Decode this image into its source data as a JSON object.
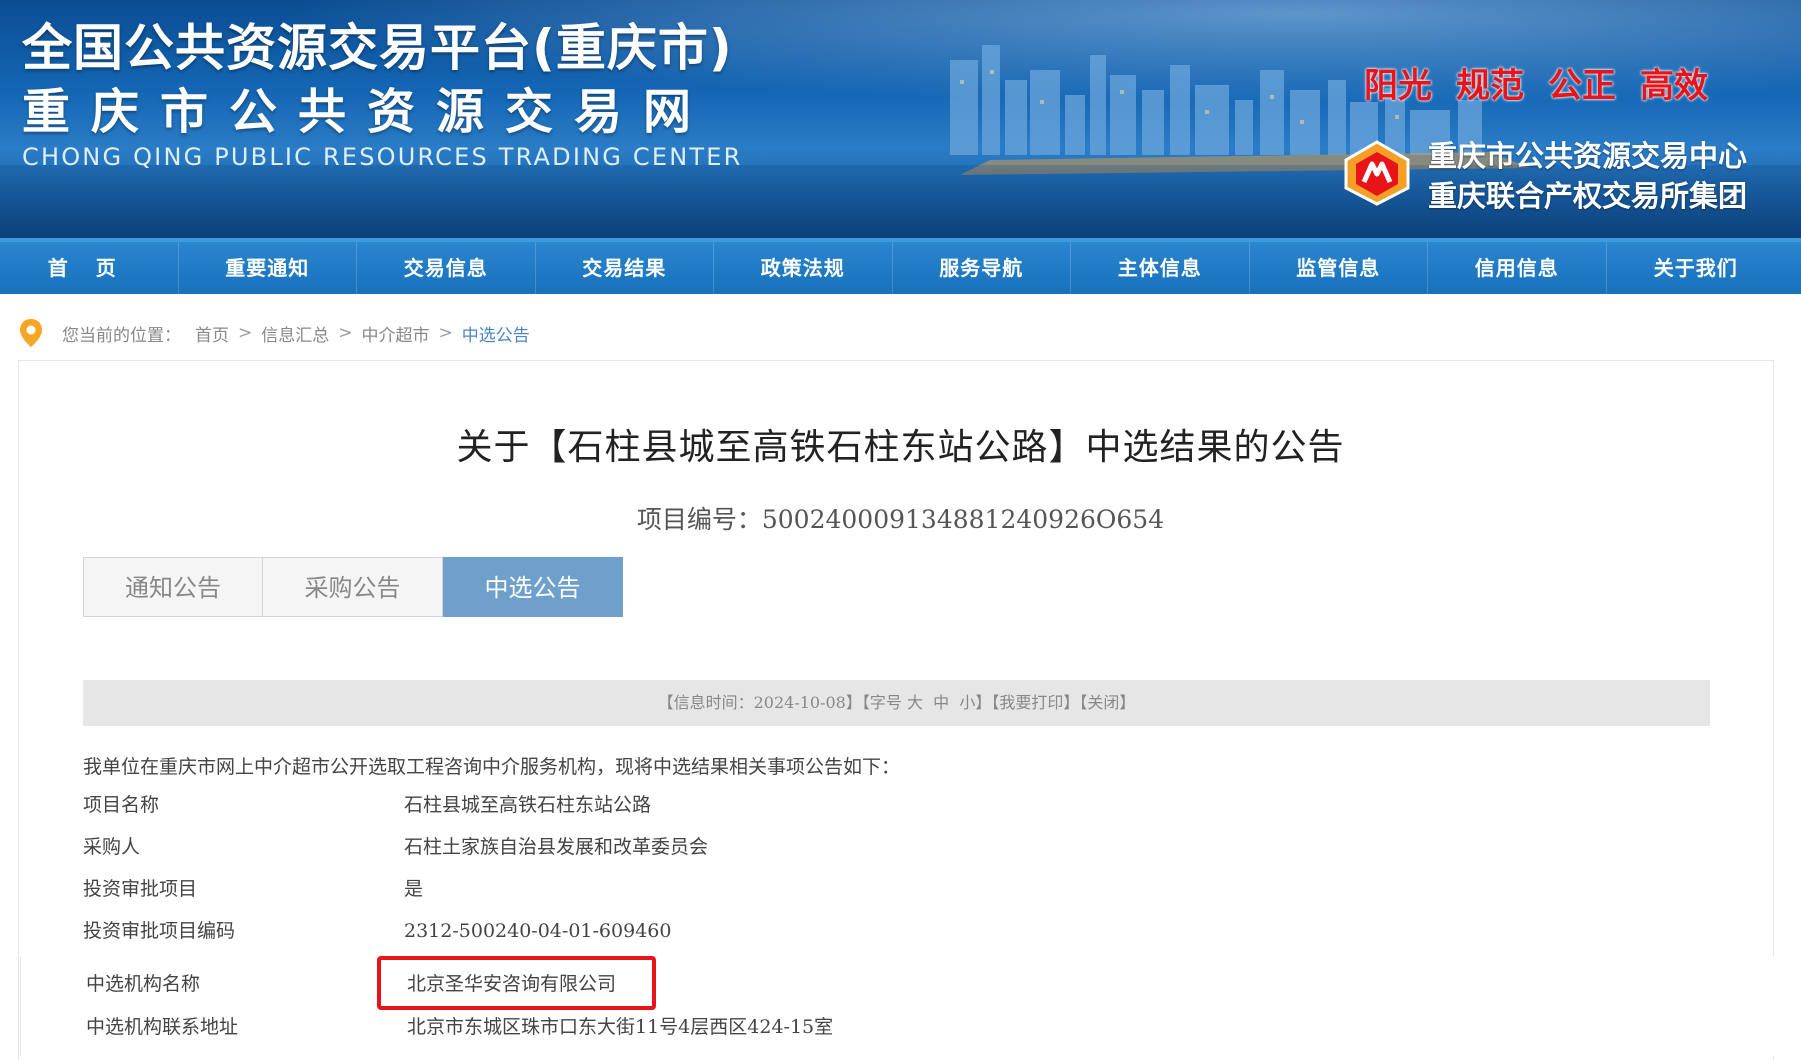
{
  "header": {
    "title": "全国公共资源交易平台(重庆市)",
    "subtitle": "重庆市公共资源交易网",
    "title_en": "CHONG QING PUBLIC RESOURCES TRADING CENTER",
    "slogans": [
      "阳光",
      "规范",
      "公正",
      "高效"
    ],
    "org_lines": [
      "重庆市公共资源交易中心",
      "重庆联合产权交易所集团"
    ],
    "colors": {
      "slogan": "#e8141a",
      "banner": "#1466b4"
    }
  },
  "nav": {
    "items": [
      "首页",
      "重要通知",
      "交易信息",
      "交易结果",
      "政策法规",
      "服务导航",
      "主体信息",
      "监管信息",
      "信用信息",
      "关于我们"
    ]
  },
  "breadcrumb": {
    "label": "您当前的位置：",
    "items": [
      "首页",
      "信息汇总",
      "中介超市",
      "中选公告"
    ],
    "separator": ">"
  },
  "article": {
    "title": "关于【石柱县城至高铁石柱东站公路】中选结果的公告",
    "project_no": "项目编号：500240009134881240926O654",
    "tabs": [
      "通知公告",
      "采购公告",
      "中选公告"
    ],
    "active_tab": "中选公告",
    "info_bar": {
      "time": "【信息时间：2024-10-08】",
      "font_prefix": "【字号",
      "font_large": "大",
      "font_medium": "中",
      "font_small": "小】",
      "print": "【我要打印】",
      "close": "【关闭】"
    },
    "intro": "我单位在重庆市网上中介超市公开选取工程咨询中介服务机构，现将中选结果相关事项公告如下：",
    "fields": [
      {
        "key": "项目名称",
        "value": "石柱县城至高铁石柱东站公路"
      },
      {
        "key": "采购人",
        "value": "石柱土家族自治县发展和改革委员会"
      },
      {
        "key": "投资审批项目",
        "value": "是"
      },
      {
        "key": "投资审批项目编码",
        "value": "2312-500240-04-01-609460"
      },
      {
        "key": "中选机构名称",
        "value": "北京圣华安咨询有限公司"
      },
      {
        "key": "中选机构联系地址",
        "value": "北京市东城区珠市口东大街11号4层西区424-15室"
      }
    ]
  }
}
